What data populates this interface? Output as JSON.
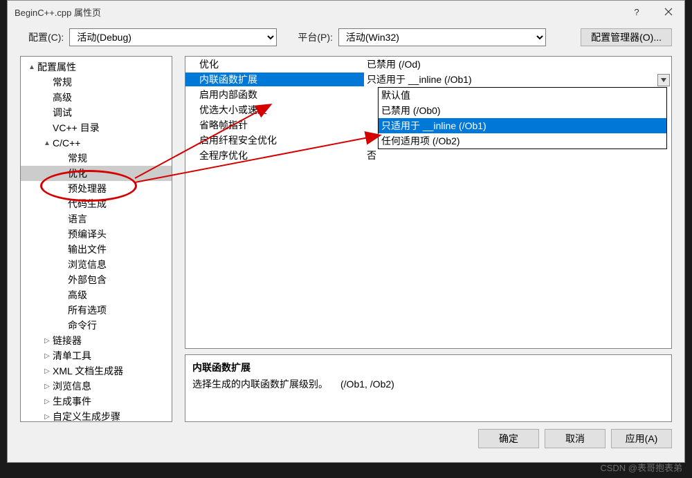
{
  "title": "BeginC++.cpp 属性页",
  "top": {
    "configLabel": "配置(C):",
    "configValue": "活动(Debug)",
    "platformLabel": "平台(P):",
    "platformValue": "活动(Win32)",
    "managerBtn": "配置管理器(O)..."
  },
  "tree": [
    {
      "label": "配置属性",
      "indent": 0,
      "twisty": "▲"
    },
    {
      "label": "常规",
      "indent": 1,
      "twisty": ""
    },
    {
      "label": "高级",
      "indent": 1,
      "twisty": ""
    },
    {
      "label": "调试",
      "indent": 1,
      "twisty": ""
    },
    {
      "label": "VC++ 目录",
      "indent": 1,
      "twisty": ""
    },
    {
      "label": "C/C++",
      "indent": 1,
      "twisty": "▲"
    },
    {
      "label": "常规",
      "indent": 2,
      "twisty": ""
    },
    {
      "label": "优化",
      "indent": 2,
      "twisty": "",
      "sel": true
    },
    {
      "label": "预处理器",
      "indent": 2,
      "twisty": ""
    },
    {
      "label": "代码生成",
      "indent": 2,
      "twisty": ""
    },
    {
      "label": "语言",
      "indent": 2,
      "twisty": ""
    },
    {
      "label": "预编译头",
      "indent": 2,
      "twisty": ""
    },
    {
      "label": "输出文件",
      "indent": 2,
      "twisty": ""
    },
    {
      "label": "浏览信息",
      "indent": 2,
      "twisty": ""
    },
    {
      "label": "外部包含",
      "indent": 2,
      "twisty": ""
    },
    {
      "label": "高级",
      "indent": 2,
      "twisty": ""
    },
    {
      "label": "所有选项",
      "indent": 2,
      "twisty": ""
    },
    {
      "label": "命令行",
      "indent": 2,
      "twisty": ""
    },
    {
      "label": "链接器",
      "indent": 1,
      "twisty": "▷"
    },
    {
      "label": "清单工具",
      "indent": 1,
      "twisty": "▷"
    },
    {
      "label": "XML 文档生成器",
      "indent": 1,
      "twisty": "▷"
    },
    {
      "label": "浏览信息",
      "indent": 1,
      "twisty": "▷"
    },
    {
      "label": "生成事件",
      "indent": 1,
      "twisty": "▷"
    },
    {
      "label": "自定义生成步骤",
      "indent": 1,
      "twisty": "▷"
    }
  ],
  "grid": [
    {
      "name": "优化",
      "value": "已禁用 (/Od)"
    },
    {
      "name": "内联函数扩展",
      "value": "只适用于 __inline (/Ob1)",
      "sel": true,
      "dropdown": true
    },
    {
      "name": "启用内部函数",
      "value": ""
    },
    {
      "name": "优选大小或速度",
      "value": ""
    },
    {
      "name": "省略帧指针",
      "value": ""
    },
    {
      "name": "启用纤程安全优化",
      "value": ""
    },
    {
      "name": "全程序优化",
      "value": "否"
    }
  ],
  "dropdown": [
    {
      "label": "默认值"
    },
    {
      "label": "已禁用 (/Ob0)"
    },
    {
      "label": "只适用于 __inline (/Ob1)",
      "sel": true
    },
    {
      "label": "任何适用项 (/Ob2)"
    }
  ],
  "desc": {
    "title": "内联函数扩展",
    "text": "选择生成的内联函数扩展级别。",
    "grey": "(/Ob1, /Ob2)"
  },
  "footer": {
    "ok": "确定",
    "cancel": "取消",
    "apply": "应用(A)"
  },
  "watermark": "CSDN @表哥抱表弟"
}
